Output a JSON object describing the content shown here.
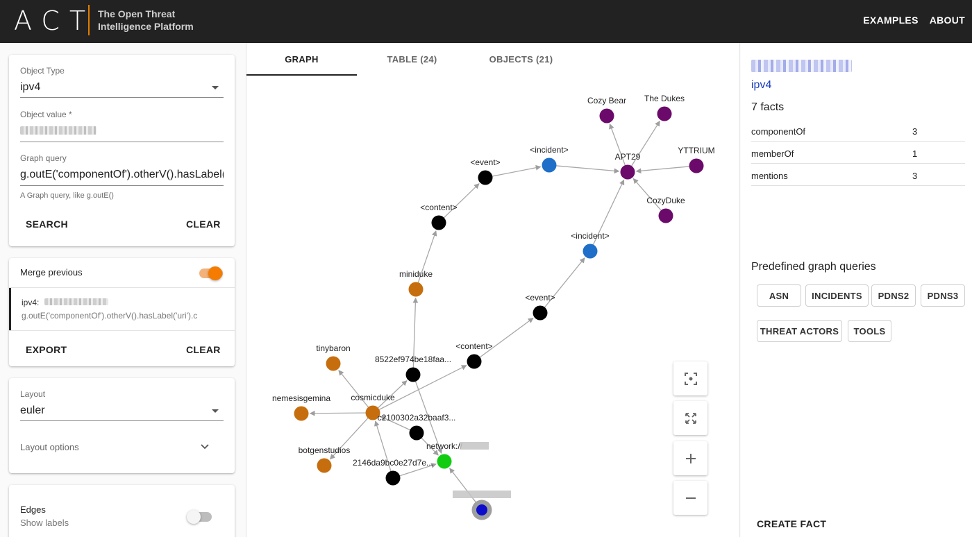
{
  "header": {
    "logo": "ACT",
    "subtitle_line1": "The Open Threat",
    "subtitle_line2": "Intelligence Platform",
    "nav": [
      "EXAMPLES",
      "ABOUT"
    ]
  },
  "search_card": {
    "object_type_label": "Object Type",
    "object_type_value": "ipv4",
    "object_value_label": "Object value *",
    "graph_query_label": "Graph query",
    "graph_query_value": "g.outE('componentOf').otherV().hasLabel(",
    "graph_query_helper": "A Graph query, like g.outE()",
    "search_button": "SEARCH",
    "clear_button": "CLEAR"
  },
  "merge_card": {
    "merge_label": "Merge previous",
    "merge_enabled": true,
    "history_prefix": "ipv4:",
    "history_query": "g.outE('componentOf').otherV().hasLabel('uri').c",
    "export_button": "EXPORT",
    "clear_button": "CLEAR"
  },
  "layout_card": {
    "layout_label": "Layout",
    "layout_value": "euler",
    "layout_options_label": "Layout options"
  },
  "edges_card": {
    "title": "Edges",
    "show_labels": "Show labels",
    "show_labels_enabled": false
  },
  "tabs": [
    {
      "label": "GRAPH",
      "active": true
    },
    {
      "label": "TABLE (24)",
      "active": false
    },
    {
      "label": "OBJECTS (21)",
      "active": false
    }
  ],
  "graph": {
    "colors": {
      "threatActor": "#6b0a6b",
      "incident": "#1f6fc9",
      "event": "#000000",
      "tool": "#c66e0e",
      "uri": "#12cc12",
      "ipv4": "#0c0ccc"
    },
    "nodes": [
      {
        "id": "cozybear",
        "label": "Cozy Bear",
        "type": "threatActor"
      },
      {
        "id": "thedukes",
        "label": "The Dukes",
        "type": "threatActor"
      },
      {
        "id": "yttrium",
        "label": "YTTRIUM",
        "type": "threatActor"
      },
      {
        "id": "cozyduke",
        "label": "CozyDuke",
        "type": "threatActor"
      },
      {
        "id": "apt29",
        "label": "APT29",
        "type": "threatActor"
      },
      {
        "id": "incident1",
        "label": "<incident>",
        "type": "incident"
      },
      {
        "id": "incident2",
        "label": "<incident>",
        "type": "incident"
      },
      {
        "id": "event1",
        "label": "<event>",
        "type": "event"
      },
      {
        "id": "event2",
        "label": "<event>",
        "type": "event"
      },
      {
        "id": "content1",
        "label": "<content>",
        "type": "event"
      },
      {
        "id": "content2",
        "label": "<content>",
        "type": "event"
      },
      {
        "id": "miniduke",
        "label": "miniduke",
        "type": "tool"
      },
      {
        "id": "hash1",
        "label": "8522ef974be18faa...",
        "type": "event"
      },
      {
        "id": "tinybaron",
        "label": "tinybaron",
        "type": "tool"
      },
      {
        "id": "cosmicduke",
        "label": "cosmicduke",
        "type": "tool"
      },
      {
        "id": "nemesisgemina",
        "label": "nemesisgemina",
        "type": "tool"
      },
      {
        "id": "hash2",
        "label": "c2100302a32baaf3...",
        "type": "event"
      },
      {
        "id": "botgenstudios",
        "label": "botgenstudios",
        "type": "tool"
      },
      {
        "id": "network",
        "label": "network://",
        "type": "uri"
      },
      {
        "id": "hash3",
        "label": "2146da9bc0e27d7e...",
        "type": "event"
      },
      {
        "id": "ip",
        "label": "",
        "type": "ipv4",
        "selected": true
      }
    ],
    "edges": [
      [
        "apt29",
        "cozybear"
      ],
      [
        "apt29",
        "thedukes"
      ],
      [
        "yttrium",
        "apt29"
      ],
      [
        "cozyduke",
        "apt29"
      ],
      [
        "incident1",
        "apt29"
      ],
      [
        "incident2",
        "apt29"
      ],
      [
        "event1",
        "incident1"
      ],
      [
        "content1",
        "event1"
      ],
      [
        "miniduke",
        "content1"
      ],
      [
        "event2",
        "incident2"
      ],
      [
        "content2",
        "event2"
      ],
      [
        "hash1",
        "miniduke"
      ],
      [
        "cosmicduke",
        "hash1"
      ],
      [
        "cosmicduke",
        "content2"
      ],
      [
        "cosmicduke",
        "tinybaron"
      ],
      [
        "cosmicduke",
        "nemesisgemina"
      ],
      [
        "cosmicduke",
        "botgenstudios"
      ],
      [
        "hash2",
        "cosmicduke"
      ],
      [
        "hash3",
        "cosmicduke"
      ],
      [
        "hash1",
        "network"
      ],
      [
        "hash2",
        "network"
      ],
      [
        "hash3",
        "network"
      ],
      [
        "ip",
        "network"
      ]
    ]
  },
  "controls": [
    "fit-icon",
    "fullscreen-icon",
    "zoom-in-icon",
    "zoom-out-icon"
  ],
  "right_panel": {
    "object_type": "ipv4",
    "facts_title": "7 facts",
    "facts": [
      {
        "name": "componentOf",
        "count": "3"
      },
      {
        "name": "memberOf",
        "count": "1"
      },
      {
        "name": "mentions",
        "count": "3"
      }
    ],
    "predefined_title": "Predefined graph queries",
    "queries": [
      "ASN",
      "INCIDENTS",
      "PDNS2",
      "PDNS3",
      "THREAT ACTORS",
      "TOOLS"
    ],
    "create_fact": "CREATE FACT"
  }
}
